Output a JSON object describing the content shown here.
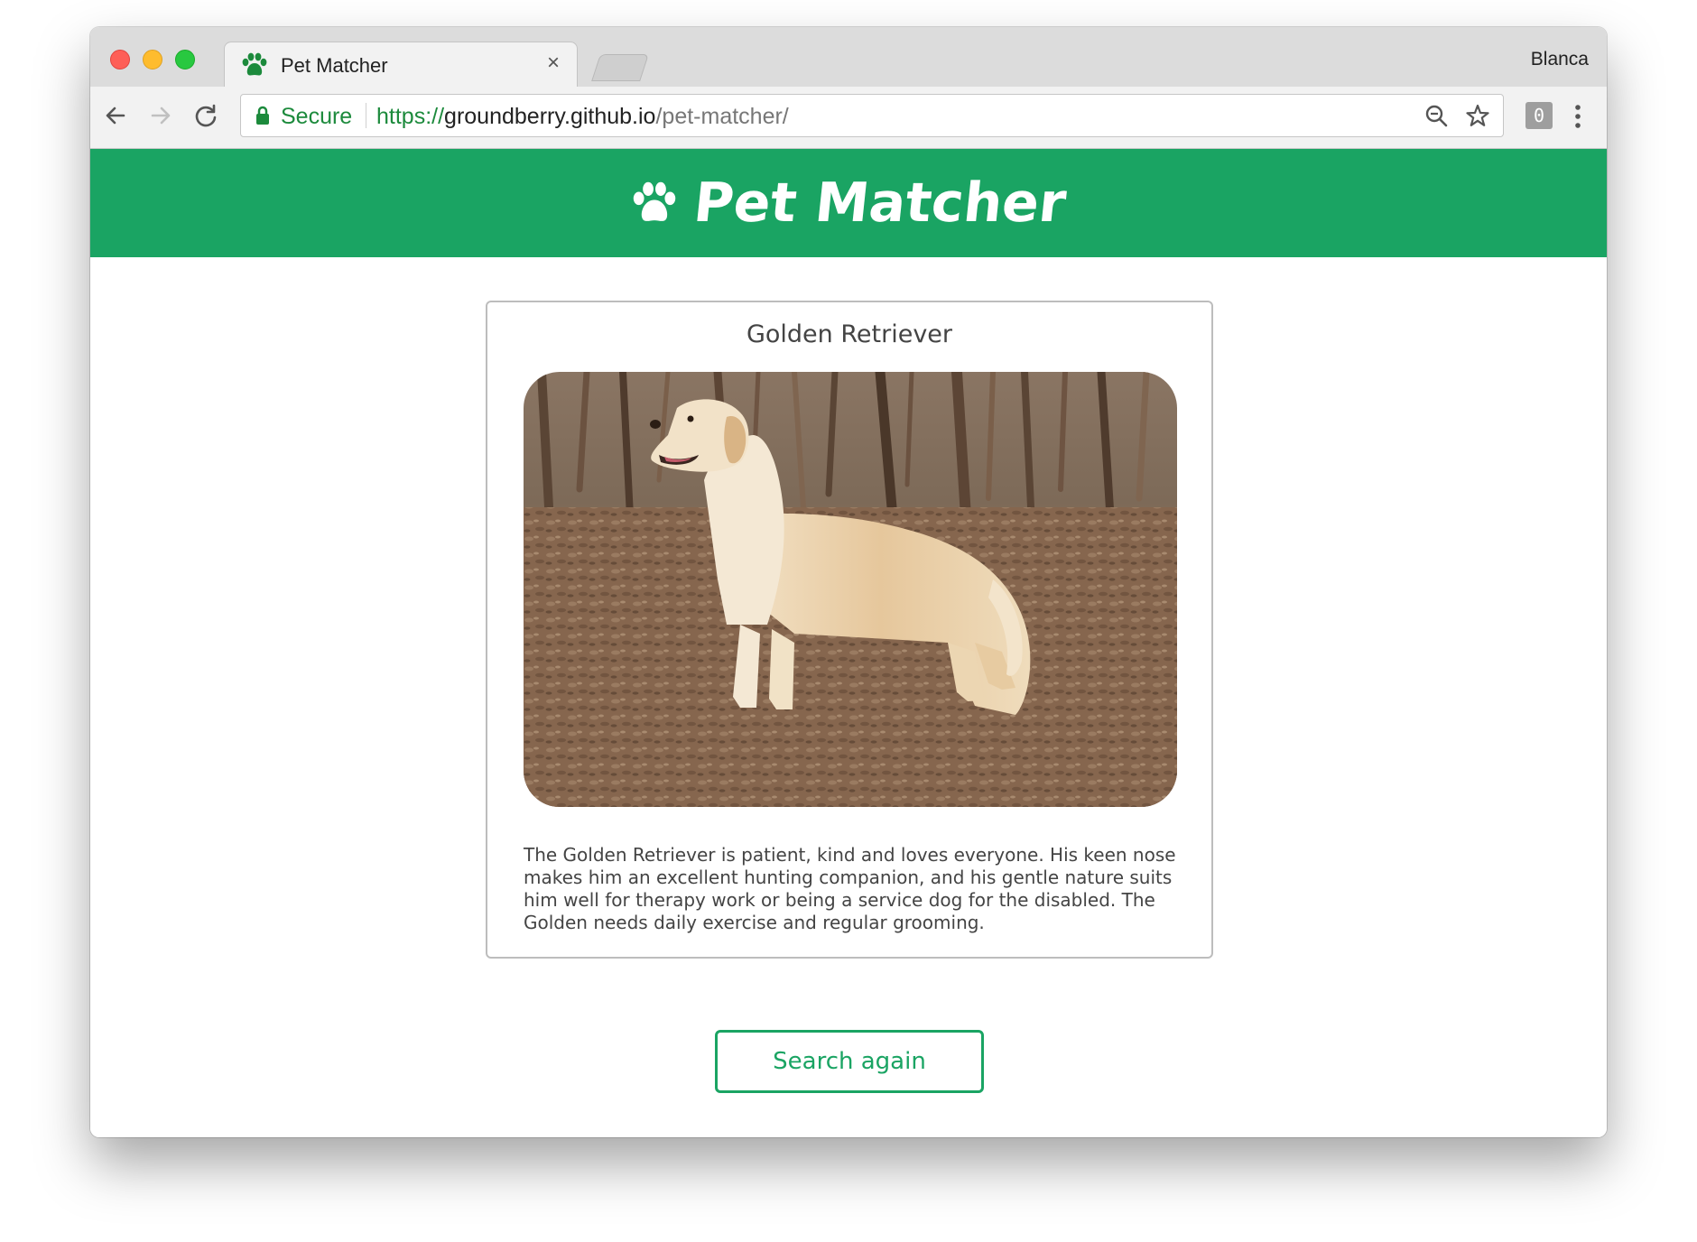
{
  "browser": {
    "tab": {
      "title": "Pet Matcher",
      "close_symbol": "×",
      "icon": "paw-icon"
    },
    "profile_name": "Blanca",
    "omnibox": {
      "secure_label": "Secure",
      "url_scheme": "https://",
      "url_host": "groundberry.github.io",
      "url_path": "/pet-matcher/"
    },
    "extension_badge": "0",
    "colors": {
      "secure": "#1c8a3c"
    }
  },
  "header": {
    "title": "Pet Matcher",
    "icon": "paw-icon",
    "color": "#1aa463"
  },
  "result": {
    "breed": "Golden Retriever",
    "image_alt": "golden retriever dog standing in autumn forest",
    "description": "The Golden Retriever is patient, kind and loves everyone. His keen nose makes him an excellent hunting companion, and his gentle nature suits him well for therapy work or being a service dog for the disabled. The Golden needs daily exercise and regular grooming."
  },
  "actions": {
    "search_again_label": "Search again"
  }
}
